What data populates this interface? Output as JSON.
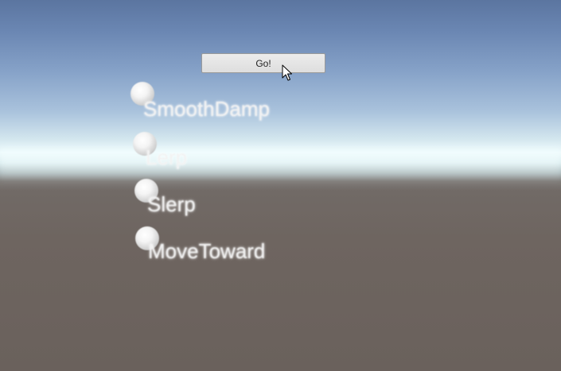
{
  "game_view": {
    "go_button_label": "Go!",
    "objects": [
      {
        "label": "SmoothDamp"
      },
      {
        "label": "Lerp"
      },
      {
        "label": "Slerp"
      },
      {
        "label": "MoveToward"
      }
    ]
  },
  "colors": {
    "sky_top": "#5b75a0",
    "horizon": "#eefbfd",
    "ground": "#6a615c"
  },
  "icons": [
    "sphere-object",
    "arrow-cursor-icon"
  ]
}
